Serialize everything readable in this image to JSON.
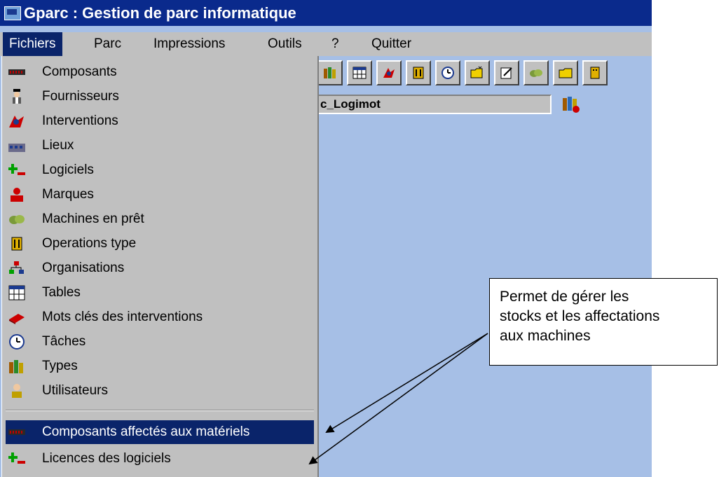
{
  "window": {
    "title": "Gparc : Gestion de parc informatique"
  },
  "menubar": {
    "items": [
      {
        "label": "Fichiers"
      },
      {
        "label": "Parc"
      },
      {
        "label": "Impressions"
      },
      {
        "label": "Outils"
      },
      {
        "label": "?"
      },
      {
        "label": "Quitter"
      }
    ]
  },
  "fichiers_menu": {
    "items": [
      {
        "label": "Composants",
        "icon": "chip-icon"
      },
      {
        "label": "Fournisseurs",
        "icon": "supplier-icon"
      },
      {
        "label": "Interventions",
        "icon": "interventions-icon"
      },
      {
        "label": "Lieux",
        "icon": "building-icon"
      },
      {
        "label": "Logiciels",
        "icon": "plus-minus-icon"
      },
      {
        "label": "Marques",
        "icon": "brand-icon"
      },
      {
        "label": "Machines en prêt",
        "icon": "loan-icon"
      },
      {
        "label": "Operations type",
        "icon": "operations-icon"
      },
      {
        "label": "Organisations",
        "icon": "org-chart-icon"
      },
      {
        "label": "Tables",
        "icon": "table-icon"
      },
      {
        "label": "Mots clés des interventions",
        "icon": "book-icon"
      },
      {
        "label": "Tâches",
        "icon": "clock-icon"
      },
      {
        "label": "Types",
        "icon": "books-icon"
      },
      {
        "label": "Utilisateurs",
        "icon": "user-icon"
      }
    ],
    "extra_items": [
      {
        "label": "Composants affectés aux matériels",
        "icon": "chip-icon",
        "selected": true
      },
      {
        "label": "Licences des logiciels",
        "icon": "plus-minus-icon"
      }
    ]
  },
  "field": {
    "value": "c_Logimot"
  },
  "callout": {
    "lines": [
      "Permet de gérer les",
      "stocks et les affectations",
      "aux machines"
    ]
  },
  "colors": {
    "title_bar": "#0a2a8c",
    "menu_bg": "#c0c0c0",
    "highlight": "#0a246a",
    "workspace": "#a6bfe6"
  }
}
